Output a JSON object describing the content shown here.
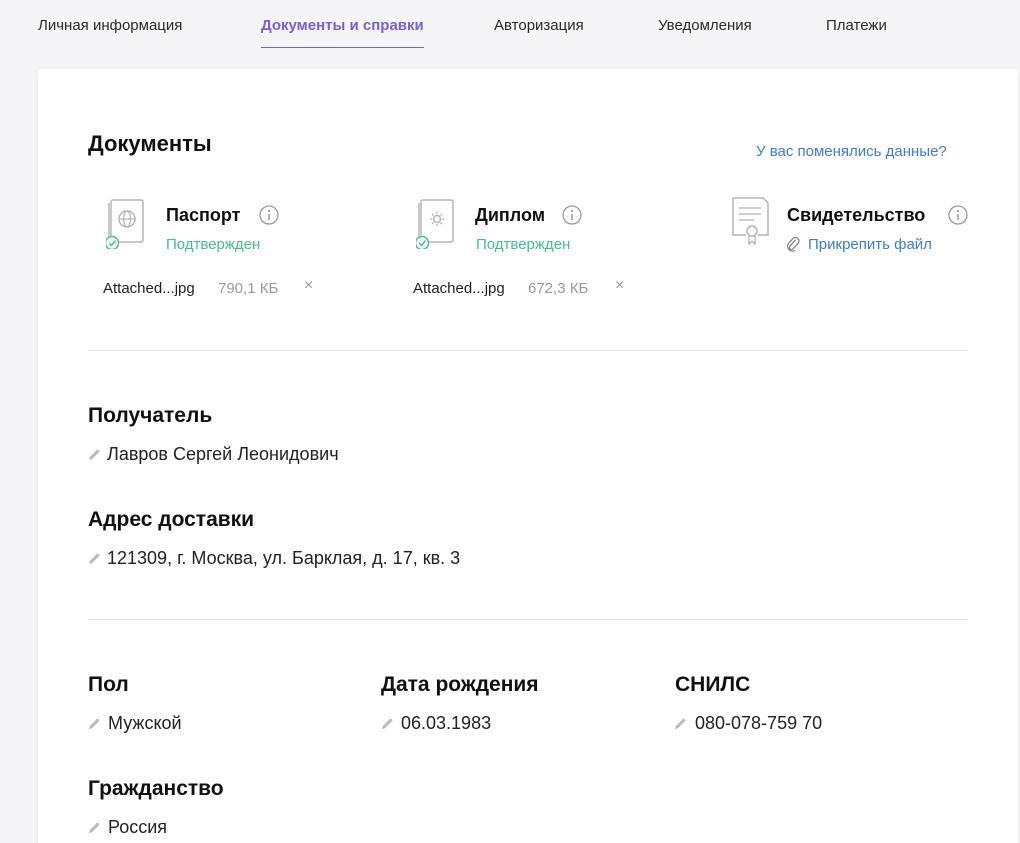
{
  "tabs": [
    {
      "label": "Личная информация"
    },
    {
      "label": "Документы и справки",
      "active": true
    },
    {
      "label": "Авторизация"
    },
    {
      "label": "Уведомления"
    },
    {
      "label": "Платежи"
    }
  ],
  "documents": {
    "title": "Документы",
    "changed_link": "У вас поменялись данные?",
    "items": [
      {
        "title": "Паспорт",
        "status": "Подтвержден",
        "file_name": "Attached...jpg",
        "file_size": "790,1 КБ",
        "remove": "×"
      },
      {
        "title": "Диплом",
        "status": "Подтвержден",
        "file_name": "Attached...jpg",
        "file_size": "672,3 КБ",
        "remove": "×"
      },
      {
        "title": "Свидетельство",
        "attach": "Прикрепить файл"
      }
    ]
  },
  "recipient": {
    "label": "Получатель",
    "value": "Лавров Сергей Леонидович"
  },
  "address": {
    "label": "Адрес доставки",
    "value": "121309, г. Москва, ул. Барклая, д. 17, кв. 3"
  },
  "gender": {
    "label": "Пол",
    "value": "Мужской"
  },
  "birthdate": {
    "label": "Дата рождения",
    "value": "06.03.1983"
  },
  "snils": {
    "label": "СНИЛС",
    "value": "080-078-759 70"
  },
  "citizenship": {
    "label": "Гражданство",
    "value": "Россия"
  },
  "colors": {
    "accent": "#7a5ed6",
    "link": "#3d7bd9",
    "success": "#3ec28f"
  }
}
